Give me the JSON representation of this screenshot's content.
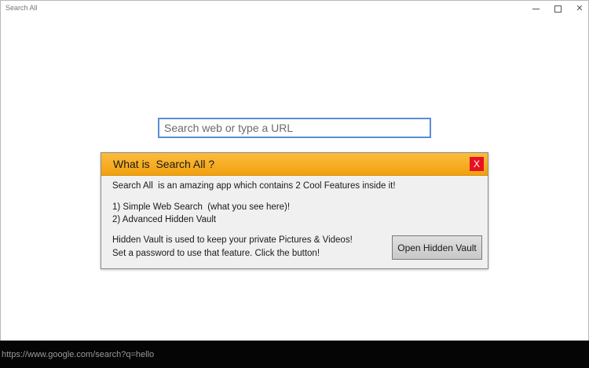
{
  "window": {
    "title": "Search All",
    "controls": {
      "minimize_icon": "minimize-icon",
      "maximize_icon": "maximize-icon",
      "close_icon": "close-icon",
      "close_glyph": "✕"
    }
  },
  "search": {
    "placeholder": "Search web or type a URL",
    "value": ""
  },
  "dialog": {
    "title": "What is  Search All ?",
    "close_label": "X",
    "intro": "Search All  is an amazing app which contains 2 Cool Features inside it!",
    "features": [
      "1) Simple Web Search  (what you see here)!",
      "2) Advanced Hidden Vault"
    ],
    "vault_line1": "Hidden Vault is used to keep your private Pictures & Videos!",
    "vault_line2": "Set a password to use that feature. Click the button!",
    "button_label": "Open Hidden Vault"
  },
  "status": {
    "url": "https://www.google.com/search?q=hello"
  },
  "colors": {
    "header_accent": "#f5a623",
    "close_red": "#e81123",
    "input_border": "#5b8ed6",
    "status_bg": "#050505"
  }
}
